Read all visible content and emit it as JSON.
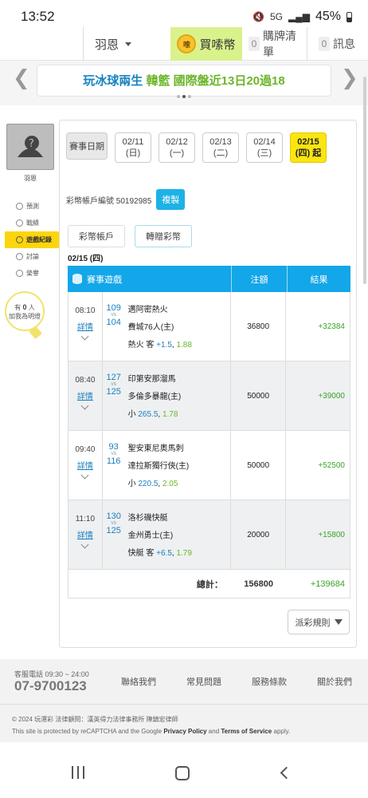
{
  "status": {
    "time": "13:52",
    "battery": "45%",
    "net": "5G"
  },
  "nav": {
    "user": "羽恩",
    "buy": "買嗦幣",
    "coin_text": "嗦",
    "cart_count": "0",
    "cart": "購牌清單",
    "msg_count": "0",
    "msg": "訊息"
  },
  "marquee": {
    "part1": "玩冰球兩生",
    "part2": "韓籃 國際盤近13日20過18"
  },
  "sidebar": {
    "name": "羽恩",
    "items": [
      {
        "label": "預測",
        "icon": "target-icon"
      },
      {
        "label": "戰績",
        "icon": "chat-icon"
      },
      {
        "label": "遊戲紀錄",
        "icon": "record-icon"
      },
      {
        "label": "討論",
        "icon": "search-icon"
      },
      {
        "label": "榮譽",
        "icon": "medal-icon"
      }
    ],
    "bulb_line1": "有",
    "bulb_count": "0",
    "bulb_line1b": "人",
    "bulb_line2": "加我為明燈"
  },
  "dates": {
    "label": "賽事日期",
    "days": [
      {
        "date": "02/11",
        "day": "(日)"
      },
      {
        "date": "02/12",
        "day": "(一)"
      },
      {
        "date": "02/13",
        "day": "(二)"
      },
      {
        "date": "02/14",
        "day": "(三)"
      },
      {
        "date": "02/15",
        "day": "(四)",
        "tag": "起"
      }
    ]
  },
  "account": {
    "label": "彩幣帳戶編號 50192985",
    "copy": "複製"
  },
  "tabs": {
    "t1": "彩幣帳戶",
    "t2": "轉贈彩幣"
  },
  "list_date": "02/15 (四)",
  "table": {
    "h_game": "賽事遊戲",
    "h_amount": "注額",
    "h_result": "結果",
    "detail_label": "詳情",
    "vs": "VS",
    "rows": [
      {
        "time": "08:10",
        "id1": "109",
        "id2": "104",
        "team1": "邁阿密熱火",
        "team2": "費城76人(主)",
        "pick_pre": "熱火 客 ",
        "pick_num": "+1.5",
        "pick_sep": ", ",
        "pick_odds": "1.88",
        "amount": "36800",
        "result": "+32384"
      },
      {
        "time": "08:40",
        "id1": "127",
        "id2": "125",
        "team1": "印第安那溜馬",
        "team2": "多倫多暴龍(主)",
        "pick_pre": "小 ",
        "pick_num": "265.5",
        "pick_sep": ", ",
        "pick_odds": "1.78",
        "amount": "50000",
        "result": "+39000"
      },
      {
        "time": "09:40",
        "id1": "93",
        "id2": "116",
        "team1": "聖安東尼奧馬刺",
        "team2": "達拉斯獨行俠(主)",
        "pick_pre": "小 ",
        "pick_num": "220.5",
        "pick_sep": ", ",
        "pick_odds": "2.05",
        "amount": "50000",
        "result": "+52500"
      },
      {
        "time": "11:10",
        "id1": "130",
        "id2": "125",
        "team1": "洛杉磯快艇",
        "team2": "金州勇士(主)",
        "pick_pre": "快艇 客 ",
        "pick_num": "+6.5",
        "pick_sep": ", ",
        "pick_odds": "1.79",
        "amount": "20000",
        "result": "+15800"
      }
    ],
    "total_label": "總計：",
    "total_amount": "156800",
    "total_result": "+139684"
  },
  "rules": "派彩規則",
  "footer": {
    "phone_label": "客服電話 09:30 ~ 24:00",
    "phone": "07-9700123",
    "links": [
      "聯絡我們",
      "常見問題",
      "服務條款",
      "關於我們"
    ],
    "copyright": "© 2024 玩運彩 法律顧問：漢英得力法律事務所 陳鎮宏律師",
    "captcha_pre": "This site is protected by reCAPTCHA and the Google ",
    "privacy": "Privacy Policy",
    "and": " and ",
    "terms": "Terms of Service",
    "apply": " apply."
  }
}
